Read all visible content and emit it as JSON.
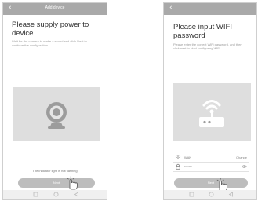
{
  "left_screen": {
    "header_title": "Add device",
    "back_glyph": "‹",
    "heading": "Please supply power to device",
    "description": "Wait for the camera to make a sound and click Next to continue the configuration.",
    "illustration_icon": "camera-icon",
    "hint": "The indicator light is not flashing",
    "next_label": "Next"
  },
  "right_screen": {
    "back_glyph": "‹",
    "heading": "Please input WIFI password",
    "description": "Please enter the correct WiFi password, and then click next to start configuring WiFi.",
    "illustration_icon": "router-icon",
    "wifi_label": "WAN",
    "change_label": "Change",
    "password_value": "•••••••",
    "next_label": "Next"
  },
  "colors": {
    "header": "#a9a9a9",
    "illustration_bg": "#dedede",
    "button": "#bdbdbd"
  }
}
